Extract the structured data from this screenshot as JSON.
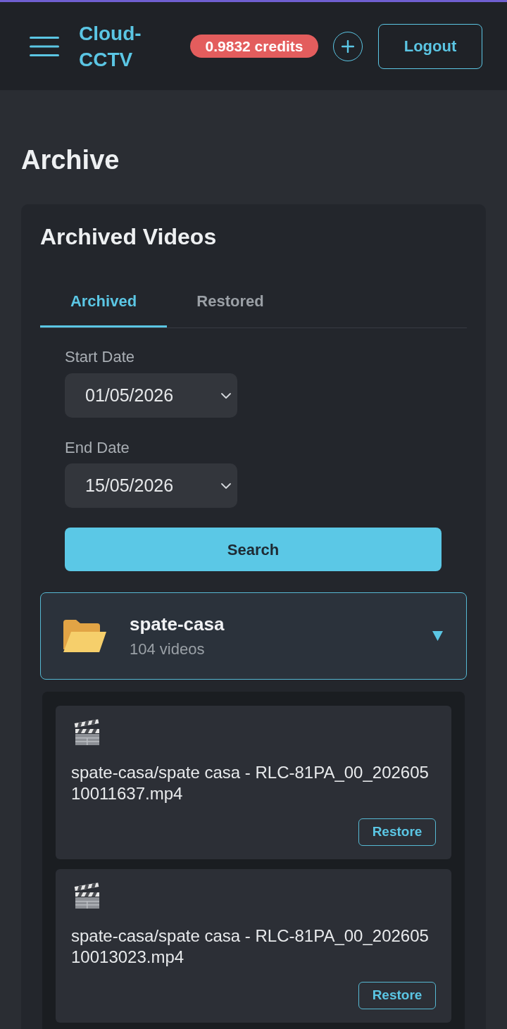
{
  "header": {
    "logo": "Cloud-CCTV",
    "credits": "0.9832 credits",
    "logout_button": "Logout"
  },
  "page_title": "Archive",
  "archive_card": {
    "title": "Archived Videos",
    "tabs": [
      {
        "label": "Archived",
        "selected": true
      },
      {
        "label": "Restored",
        "selected": false
      }
    ],
    "filters": [
      {
        "label": "Start Date",
        "value": "01/05/2026"
      },
      {
        "label": "End Date",
        "value": "15/05/2026"
      }
    ],
    "search_button": "Search",
    "folders": [
      {
        "name": "spate-casa",
        "count": "104 videos",
        "expanded": true,
        "videos": [
          {
            "filename": "spate-casa/spate casa - RLC-81PA_00_20260510011637.mp4",
            "action": "Restore"
          },
          {
            "filename": "spate-casa/spate casa - RLC-81PA_00_20260510013023.mp4",
            "action": "Restore"
          }
        ]
      }
    ]
  }
}
